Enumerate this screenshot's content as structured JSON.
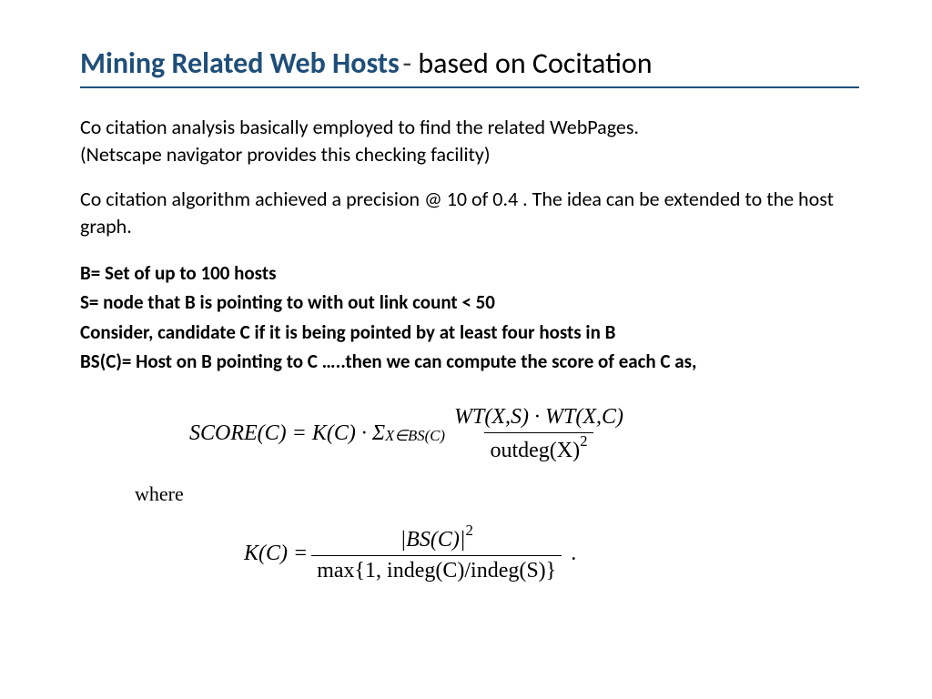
{
  "title": {
    "blue": "Mining Related Web Hosts",
    "dash": "-",
    "black": "based on Cocitation"
  },
  "body": {
    "p1_line1": "Co citation analysis basically employed to find the related WebPages.",
    "p1_line2": "(Netscape navigator provides this checking facility)",
    "p2": "Co citation  algorithm achieved a precision @ 10 of 0.4 . The idea can be extended to the host graph."
  },
  "defs": {
    "d1": "B= Set of up to 100 hosts",
    "d2": "S= node that B is pointing to with out link count < 50",
    "d3": "Consider, candidate C if it is being pointed by at least four hosts in B",
    "d4": "BS(C)= Host on B pointing to C …..then we can compute the score of each C as,"
  },
  "formula1": {
    "lhs": "SCORE(C) = K(C) · Σ",
    "sub": "X∈BS(C)",
    "num": "WT(X,S) · WT(X,C)",
    "den_a": "outdeg(X)",
    "den_exp": "2"
  },
  "where": "where",
  "formula2": {
    "lhs": "K(C) = ",
    "num_a": "|BS(C)|",
    "num_exp": "2",
    "den": "max{1, indeg(C)/indeg(S)}",
    "tail": "."
  }
}
